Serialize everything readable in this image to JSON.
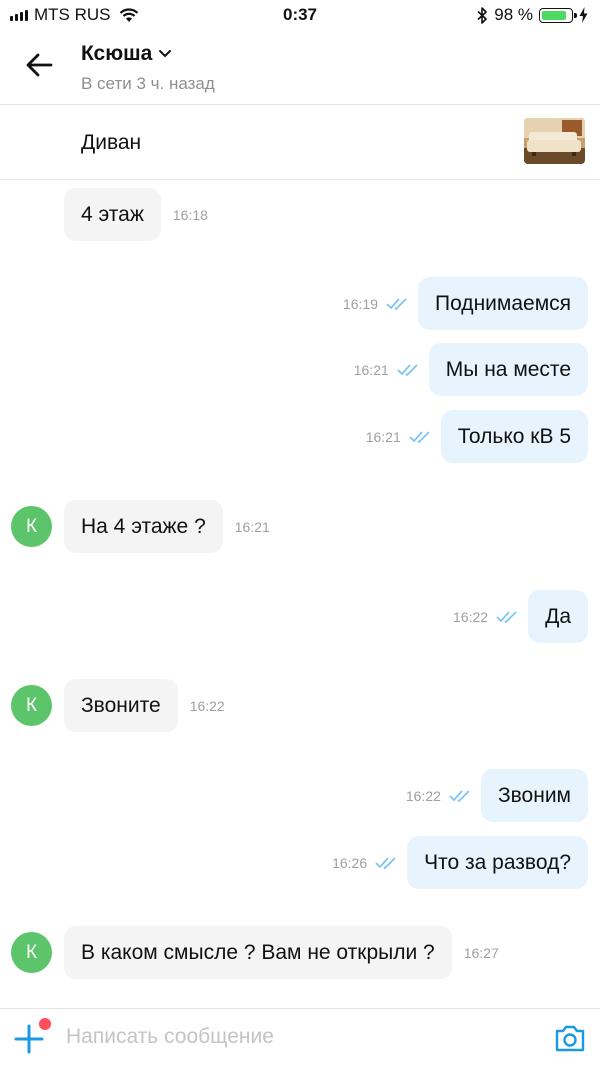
{
  "status_bar": {
    "carrier": "MTS RUS",
    "time": "0:37",
    "battery": "98 %",
    "battery_level": 0.98
  },
  "header": {
    "name": "Ксюша",
    "status": "В сети 3 ч. назад"
  },
  "listing": {
    "title": "Диван"
  },
  "messages": [
    {
      "dir": "in",
      "text": "4 этаж",
      "time": "16:18",
      "avatar": false
    },
    {
      "dir": "out",
      "text": "Поднимаемся",
      "time": "16:19",
      "read": true
    },
    {
      "dir": "out",
      "text": "Мы на месте",
      "time": "16:21",
      "read": true
    },
    {
      "dir": "out",
      "text": "Только кВ 5",
      "time": "16:21",
      "read": true
    },
    {
      "dir": "in",
      "text": "На 4 этаже ?",
      "time": "16:21",
      "avatar": true,
      "avatar_letter": "К"
    },
    {
      "dir": "out",
      "text": "Да",
      "time": "16:22",
      "read": true
    },
    {
      "dir": "in",
      "text": "Звоните",
      "time": "16:22",
      "avatar": true,
      "avatar_letter": "К"
    },
    {
      "dir": "out",
      "text": "Звоним",
      "time": "16:22",
      "read": true
    },
    {
      "dir": "out",
      "text": "Что за развод?",
      "time": "16:26",
      "read": true
    },
    {
      "dir": "in",
      "text": "В каком смысле ? Вам не открыли ?",
      "time": "16:27",
      "avatar": true,
      "avatar_letter": "К"
    }
  ],
  "composer": {
    "placeholder": "Написать сообщение"
  },
  "colors": {
    "accent": "#1a9ae0",
    "avatar": "#5cc46a",
    "incoming_bubble": "#f4f4f4",
    "outgoing_bubble": "#e7f4fd",
    "read_check": "#7cc6f0",
    "notification_dot": "#ff4d5e"
  },
  "icons": {
    "back": "arrow-left-icon",
    "dropdown": "chevron-down-icon",
    "attach": "plus-icon",
    "camera": "camera-icon",
    "read": "double-check-icon"
  }
}
